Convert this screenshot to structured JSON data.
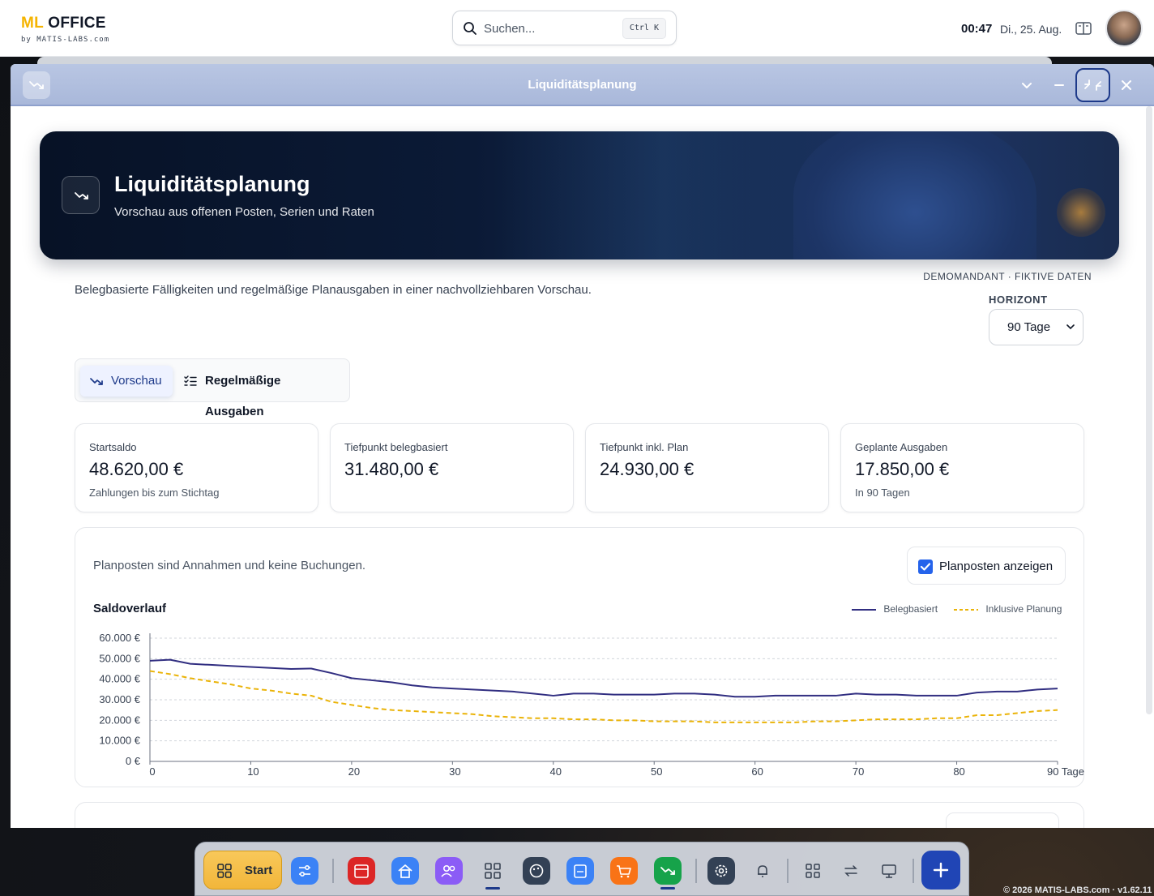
{
  "topbar": {
    "logo_ml": "ML",
    "logo_office": "OFFICE",
    "logo_sub": "by MATIS-LABS.com",
    "search_placeholder": "Suchen...",
    "search_shortcut": "Ctrl K",
    "time": "00:47",
    "date": "Di., 25. Aug."
  },
  "window": {
    "title": "Liquiditätsplanung"
  },
  "hero": {
    "title": "Liquiditätsplanung",
    "subtitle": "Vorschau aus offenen Posten, Serien und Raten"
  },
  "meta": {
    "demo_tag": "DEMOMANDANT · FIKTIVE DATEN",
    "intro": "Belegbasierte Fälligkeiten und regelmäßige Planausgaben in einer nachvollziehbaren Vorschau.",
    "horizon_label": "HORIZONT",
    "horizon_value": "90 Tage"
  },
  "tabs": [
    {
      "label": "Vorschau",
      "active": true
    },
    {
      "label": "Regelmäßige Ausgaben",
      "active": false
    }
  ],
  "cards": [
    {
      "label": "Startsaldo",
      "value": "48.620,00 €",
      "note": "Zahlungen bis zum Stichtag"
    },
    {
      "label": "Tiefpunkt belegbasiert",
      "value": "31.480,00 €",
      "note": ""
    },
    {
      "label": "Tiefpunkt inkl. Plan",
      "value": "24.930,00 €",
      "note": ""
    },
    {
      "label": "Geplante Ausgaben",
      "value": "17.850,00 €",
      "note": "In 90 Tagen"
    }
  ],
  "chart_panel": {
    "disclaimer": "Planposten sind Annahmen und keine Buchungen.",
    "plan_toggle_label": "Planposten anzeigen",
    "plan_toggle_checked": true
  },
  "chart_data": {
    "type": "line",
    "title": "Saldoverlauf",
    "xlabel": "",
    "ylabel": "",
    "x_unit_label": "Tage",
    "xlim": [
      0,
      90
    ],
    "ylim": [
      0,
      60000
    ],
    "x_ticks": [
      0,
      10,
      20,
      30,
      40,
      50,
      60,
      70,
      80,
      90
    ],
    "x_tick_labels": [
      "0",
      "10",
      "20",
      "30",
      "40",
      "50",
      "60",
      "70",
      "80",
      "90 Tage"
    ],
    "y_ticks": [
      0,
      10000,
      20000,
      30000,
      40000,
      50000,
      60000
    ],
    "y_tick_labels": [
      "0 €",
      "10.000 €",
      "20.000 €",
      "30.000 €",
      "40.000 €",
      "50.000 €",
      "60.000 €"
    ],
    "grid": true,
    "legend_position": "top-right",
    "x": [
      0,
      2,
      4,
      6,
      8,
      10,
      12,
      14,
      16,
      18,
      20,
      22,
      24,
      26,
      28,
      30,
      32,
      34,
      36,
      38,
      40,
      42,
      44,
      46,
      48,
      50,
      52,
      54,
      56,
      58,
      60,
      62,
      64,
      66,
      68,
      70,
      72,
      74,
      76,
      78,
      80,
      82,
      84,
      86,
      88,
      90
    ],
    "series": [
      {
        "name": "Belegbasiert",
        "color": "#312e81",
        "style": "solid",
        "values": [
          49000,
          49500,
          47500,
          47000,
          46500,
          46000,
          45500,
          45000,
          45200,
          43000,
          40500,
          39500,
          38500,
          37000,
          36000,
          35500,
          35000,
          34500,
          34000,
          33000,
          32000,
          33000,
          33000,
          32500,
          32500,
          32500,
          33000,
          33000,
          32500,
          31500,
          31500,
          32000,
          32000,
          32000,
          32000,
          33000,
          32500,
          32500,
          32000,
          32000,
          32000,
          33500,
          34000,
          34000,
          35000,
          35500
        ],
        "low_point": 31480
      },
      {
        "name": "Inklusive Planung",
        "color": "#eab308",
        "style": "dashed",
        "values": [
          44000,
          42500,
          40500,
          39000,
          37500,
          35500,
          34500,
          33000,
          32000,
          29000,
          27500,
          26000,
          25000,
          24500,
          24000,
          23500,
          23000,
          22000,
          21500,
          21000,
          21000,
          20500,
          20500,
          20000,
          20000,
          19500,
          19500,
          19500,
          19000,
          19000,
          19000,
          19000,
          19000,
          19500,
          19500,
          20000,
          20500,
          20500,
          20500,
          21000,
          21000,
          22500,
          22500,
          23500,
          24500,
          25000
        ],
        "low_point": 24930
      }
    ]
  },
  "dock": {
    "start_label": "Start"
  },
  "footer": {
    "copyright": "© 2026 MATIS-LABS.com · v1.62.11"
  }
}
